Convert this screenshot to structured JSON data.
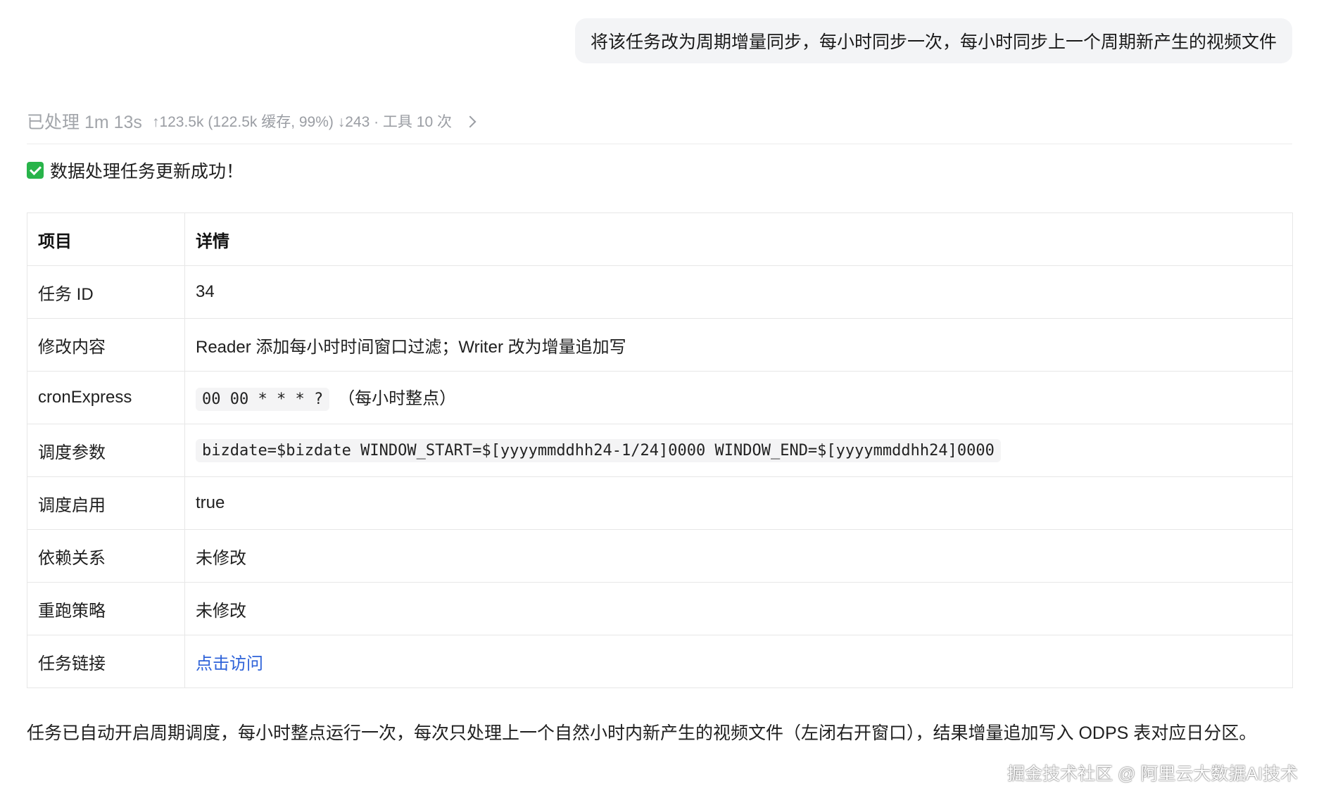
{
  "user_message": "将该任务改为周期增量同步，每小时同步一次，每小时同步上一个周期新产生的视频文件",
  "processing": {
    "title": "已处理 1m 13s",
    "stats": "↑123.5k (122.5k 缓存, 99%) ↓243 · 工具 10 次"
  },
  "success_message": "数据处理任务更新成功！",
  "table": {
    "headers": [
      "项目",
      "详情"
    ],
    "rows": [
      {
        "key": "任务 ID",
        "value": "34"
      },
      {
        "key": "修改内容",
        "value": "Reader 添加每小时时间窗口过滤；Writer 改为增量追加写"
      },
      {
        "key": "cronExpress",
        "code": "00 00 * * * ?",
        "value": "（每小时整点）"
      },
      {
        "key": "调度参数",
        "code": "bizdate=$bizdate WINDOW_START=$[yyyymmddhh24-1/24]0000 WINDOW_END=$[yyyymmddhh24]0000"
      },
      {
        "key": "调度启用",
        "value": "true"
      },
      {
        "key": "依赖关系",
        "value": "未修改"
      },
      {
        "key": "重跑策略",
        "value": "未修改"
      },
      {
        "key": "任务链接",
        "link": "点击访问"
      }
    ]
  },
  "summary": "任务已自动开启周期调度，每小时整点运行一次，每次只处理上一个自然小时内新产生的视频文件（左闭右开窗口），结果增量追加写入 ODPS 表对应日分区。",
  "watermark": "掘金技术社区 @ 阿里云大数据AI技术",
  "colors": {
    "link": "#2f63d9",
    "success_icon": "#28b44a",
    "bubble_bg": "#f3f4f6"
  },
  "icons": {
    "success": "check-mark-button-icon",
    "expand": "chevron-right-icon"
  }
}
